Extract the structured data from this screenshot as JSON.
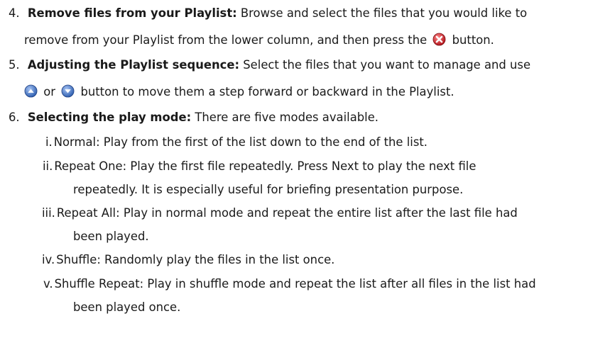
{
  "items": [
    {
      "number": "4.",
      "heading": "Remove files from your Playlist:",
      "text_line1": " Browse and select the files that you would like to",
      "text_line2_a": "remove from your Playlist from the lower column, and then press the",
      "icon": "remove-x-icon",
      "text_line2_b": "button."
    },
    {
      "number": "5.",
      "heading": "Adjusting the Playlist sequence:",
      "text_line1": " Select the files that you want to manage and use",
      "icon_up": "move-up-icon",
      "or_text": "or",
      "icon_down": "move-down-icon",
      "text_line2": "button to move them a step forward or backward in the Playlist."
    },
    {
      "number": "6.",
      "heading": "Selecting the play mode:",
      "text_line1": " There are five modes available."
    }
  ],
  "modes": [
    {
      "numeral": "i.",
      "text": "Normal: Play from the first of the list down to the end of the list."
    },
    {
      "numeral": "ii.",
      "text": "Repeat One: Play the first file repeatedly. Press Next to play the next file",
      "cont": "repeatedly. It is especially useful for briefing presentation purpose."
    },
    {
      "numeral": "iii.",
      "text": "Repeat All: Play in normal mode and repeat the entire list after the last file had",
      "cont": "been played."
    },
    {
      "numeral": "iv.",
      "text": "Shuffle: Randomly play the files in the list once."
    },
    {
      "numeral": "v.",
      "text": "Shuffle Repeat: Play in shuffle mode and repeat the list after all files in the list had",
      "cont": "been played once."
    }
  ],
  "colors": {
    "icon_blue": "#3f6fc1",
    "icon_red": "#c8242b"
  }
}
